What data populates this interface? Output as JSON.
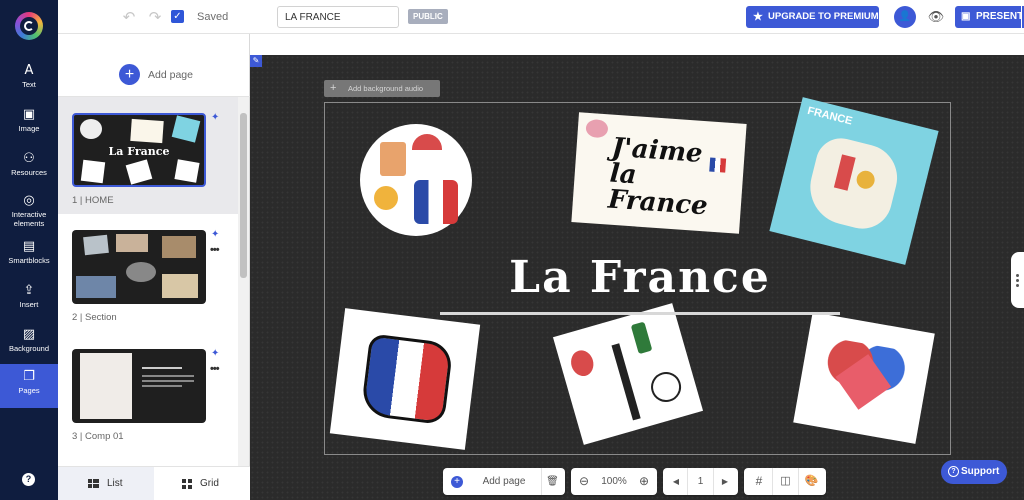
{
  "topbar": {
    "undo_icon": "undo-icon",
    "redo_icon": "redo-icon",
    "saved_label": "Saved",
    "title_value": "LA FRANCE",
    "public_badge": "PUBLIC",
    "upgrade_label": "UPGRADE TO PREMIUM",
    "present_label": "PRESENT"
  },
  "rail": {
    "items": [
      {
        "label": "Text",
        "icon": "A"
      },
      {
        "label": "Image",
        "icon": "▣"
      },
      {
        "label": "Resources",
        "icon": "⚇"
      },
      {
        "label": "Interactive elements",
        "icon": "◎"
      },
      {
        "label": "Smartblocks",
        "icon": "▤"
      },
      {
        "label": "Insert",
        "icon": "⇪"
      },
      {
        "label": "Background",
        "icon": "▨"
      },
      {
        "label": "Pages",
        "icon": "❐"
      }
    ],
    "help": "?"
  },
  "panel": {
    "add_page_label": "Add page",
    "pages": [
      {
        "number": "1 |",
        "name": "HOME",
        "thumb_title": "La France"
      },
      {
        "number": "2 |",
        "name": "Section"
      },
      {
        "number": "3 |",
        "name": "Comp 01"
      }
    ],
    "tabs": {
      "list": "List",
      "grid": "Grid"
    }
  },
  "canvas": {
    "bg_audio_label": "Add background audio",
    "title": "La France",
    "jaime_text": "J'aime la France",
    "map_text": "FRANCE"
  },
  "bottom": {
    "add_page_label": "Add page",
    "zoom": "100%",
    "page_number": "1"
  },
  "support_label": "Support",
  "colors": {
    "accent": "#3d59d6",
    "rail": "#0f1d3f"
  }
}
